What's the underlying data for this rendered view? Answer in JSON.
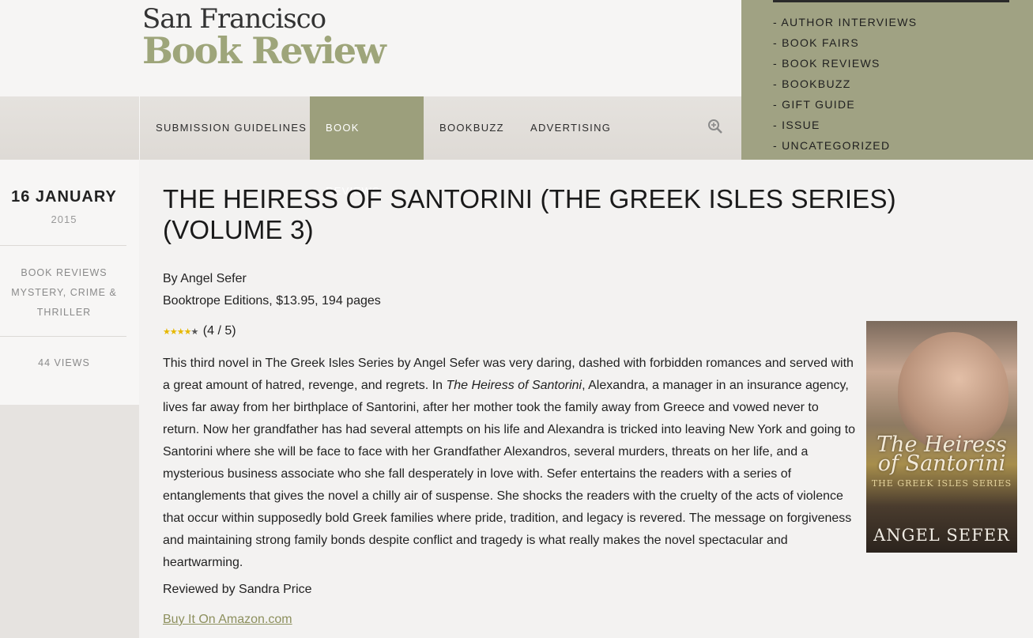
{
  "logo": {
    "line1": "San Francisco",
    "line2": "Book Review"
  },
  "nav": {
    "items": [
      {
        "label": "SUBMISSION GUIDELINES",
        "active": false
      },
      {
        "label": "BOOK REVIEWS",
        "active": true
      },
      {
        "label": "BOOKBUZZ",
        "active": false
      },
      {
        "label": "ADVERTISING",
        "active": false
      }
    ],
    "search_icon": "search-zoom-icon"
  },
  "categories": [
    "- AUTHOR INTERVIEWS",
    "- BOOK FAIRS",
    "- BOOK REVIEWS",
    "- BOOKBUZZ",
    "- GIFT GUIDE",
    "- ISSUE",
    "- UNCATEGORIZED"
  ],
  "post_meta": {
    "date_day": "16 JANUARY",
    "date_year": "2015",
    "tags": [
      "BOOK REVIEWS",
      "MYSTERY, CRIME &",
      "THRILLER"
    ],
    "views": "44 VIEWS"
  },
  "post": {
    "title": "THE HEIRESS OF SANTORINI (THE GREEK ISLES SERIES) (VOLUME 3)",
    "author_line": "By Angel Sefer",
    "publisher_line": "Booktrope Editions, $13.95, 194 pages",
    "rating_value": 4,
    "rating_max": 5,
    "rating_text": "(4 / 5)",
    "body_pre": "This third novel in The Greek Isles Series by Angel Sefer was very daring, dashed with forbidden romances and served with a great amount of hatred, revenge, and regrets. In ",
    "body_italic": "The Heiress of Santorini",
    "body_post": ", Alexandra,  a manager in an insurance agency, lives far away from her birthplace of Santorini, after her mother took the family away from Greece and vowed never to return. Now her grandfather has had several attempts on his life and Alexandra is tricked into leaving New York and going to Santorini where she will be face to face with her Grandfather Alexandros, several murders, threats on her life, and a mysterious business associate who she fall desperately in love with. Sefer entertains the readers with a series of entanglements that gives the novel a chilly air of suspense. She shocks the readers with the cruelty of the acts of violence that occur within supposedly bold Greek families where pride, tradition, and legacy is revered. The message on forgiveness and maintaining strong family bonds despite conflict and tragedy is what really makes the novel spectacular and heartwarming.",
    "reviewed_by": "Reviewed by Sandra Price",
    "buy_link": "Buy It On Amazon.com"
  },
  "cover": {
    "title": "The Heiress of Santorini",
    "series": "THE GREEK ISLES SERIES",
    "author": "ANGEL SEFER"
  },
  "colors": {
    "accent_olive": "#9c9f7c",
    "logo_green": "#9ea57a",
    "link": "#8d905e",
    "star": "#e6b800"
  }
}
